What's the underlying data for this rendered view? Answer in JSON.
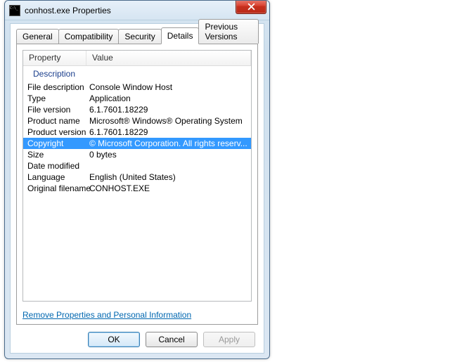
{
  "window": {
    "title": "conhost.exe Properties"
  },
  "tabs": {
    "general": "General",
    "compatibility": "Compatibility",
    "security": "Security",
    "details": "Details",
    "previous": "Previous Versions"
  },
  "columns": {
    "property": "Property",
    "value": "Value"
  },
  "group": "Description",
  "rows": [
    {
      "prop": "File description",
      "val": "Console Window Host",
      "sel": false
    },
    {
      "prop": "Type",
      "val": "Application",
      "sel": false
    },
    {
      "prop": "File version",
      "val": "6.1.7601.18229",
      "sel": false
    },
    {
      "prop": "Product name",
      "val": "Microsoft® Windows® Operating System",
      "sel": false
    },
    {
      "prop": "Product version",
      "val": "6.1.7601.18229",
      "sel": false
    },
    {
      "prop": "Copyright",
      "val": "© Microsoft Corporation. All rights reserv...",
      "sel": true
    },
    {
      "prop": "Size",
      "val": "0 bytes",
      "sel": false
    },
    {
      "prop": "Date modified",
      "val": "",
      "sel": false
    },
    {
      "prop": "Language",
      "val": "English (United States)",
      "sel": false
    },
    {
      "prop": "Original filename",
      "val": "CONHOST.EXE",
      "sel": false
    }
  ],
  "link": "Remove Properties and Personal Information",
  "buttons": {
    "ok": "OK",
    "cancel": "Cancel",
    "apply": "Apply"
  }
}
